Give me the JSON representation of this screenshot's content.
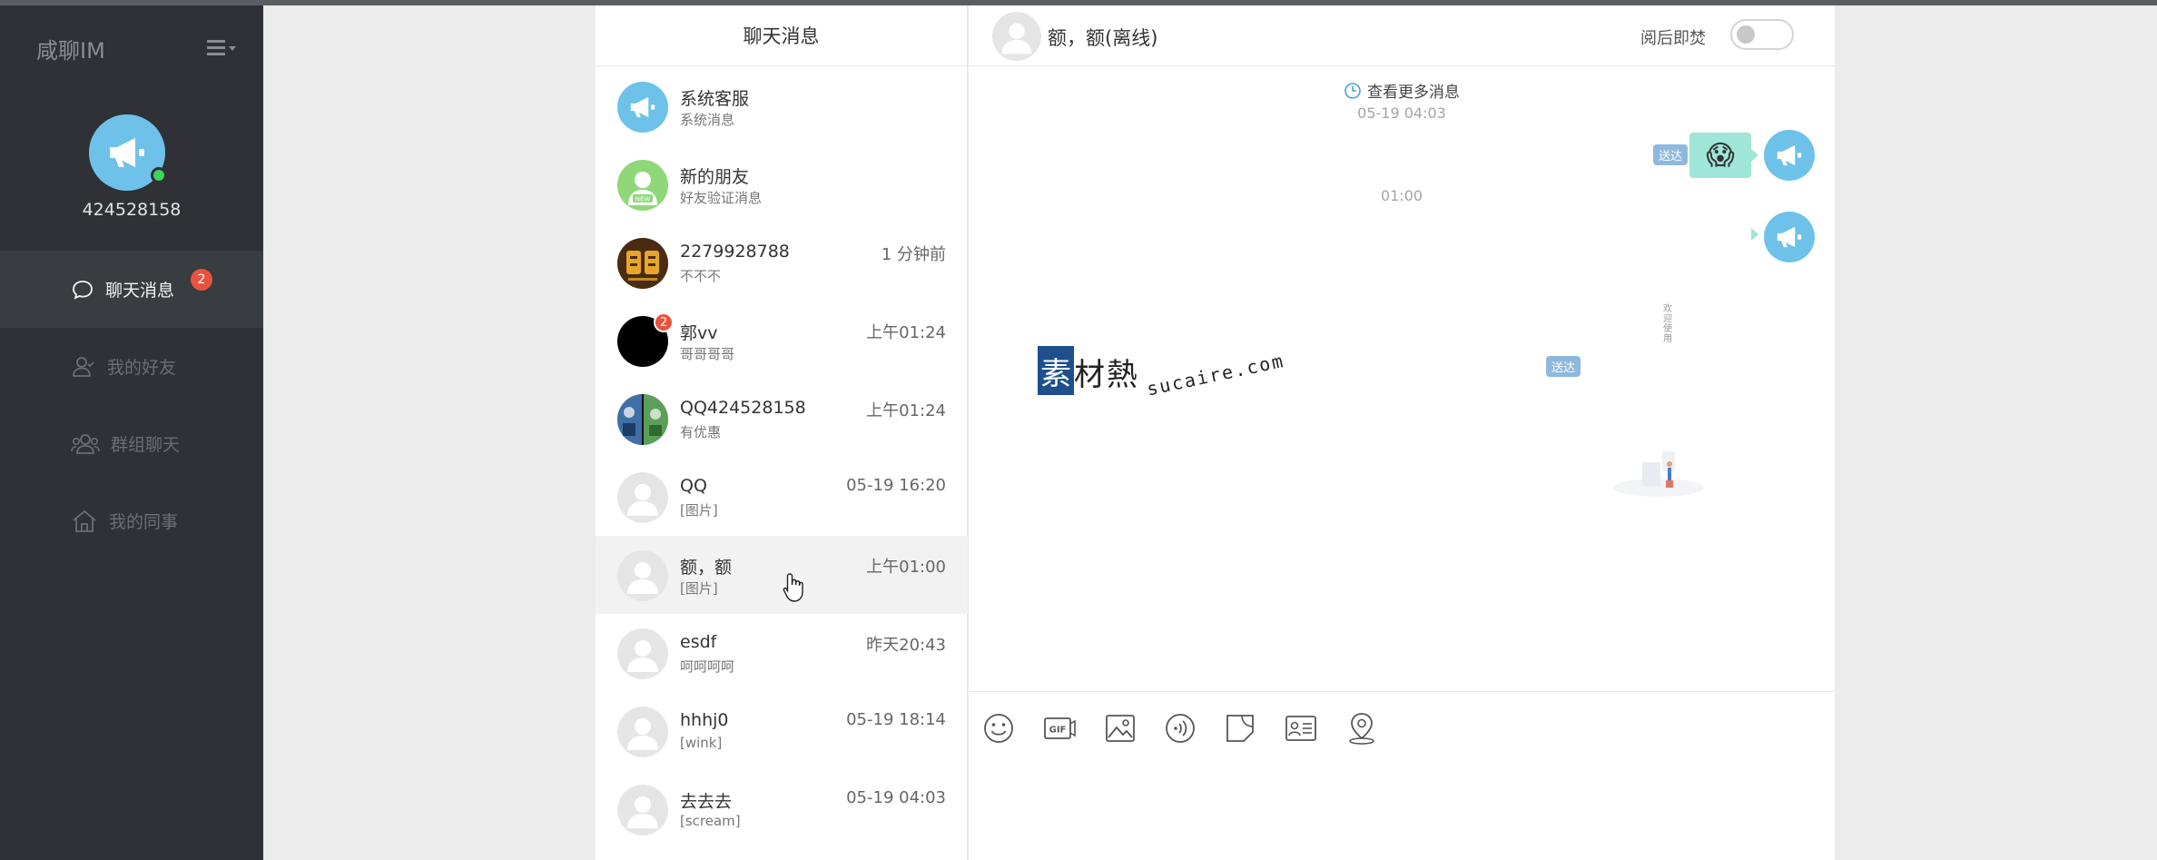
{
  "app": {
    "brand": "咸聊IM"
  },
  "user": {
    "id": "424528158"
  },
  "nav": {
    "items": [
      {
        "label": "聊天消息",
        "badge": "2",
        "active": true
      },
      {
        "label": "我的好友"
      },
      {
        "label": "群组聊天"
      },
      {
        "label": "我的同事"
      }
    ]
  },
  "chatlist": {
    "title": "聊天消息",
    "items": [
      {
        "name": "系统客服",
        "msg": "系统消息",
        "time": "",
        "avatar": "megaphone"
      },
      {
        "name": "新的朋友",
        "msg": "好友验证消息",
        "time": "",
        "avatar": "new-friend"
      },
      {
        "name": "2279928788",
        "msg": "不不不",
        "time": "1 分钟前",
        "avatar": "logo"
      },
      {
        "name": "郭vv",
        "msg": "哥哥哥哥",
        "time": "上午01:24",
        "avatar": "black",
        "badge": "2"
      },
      {
        "name": "QQ424528158",
        "msg": "有优惠",
        "time": "上午01:24",
        "avatar": "photo"
      },
      {
        "name": "QQ",
        "msg": "[图片]",
        "time": "05-19 16:20",
        "avatar": "default"
      },
      {
        "name": "额，额",
        "msg": "[图片]",
        "time": "上午01:00",
        "avatar": "default",
        "hover": true
      },
      {
        "name": "esdf",
        "msg": "呵呵呵呵",
        "time": "昨天20:43",
        "avatar": "default"
      },
      {
        "name": "hhhj0",
        "msg": "[wink]",
        "time": "05-19 18:14",
        "avatar": "default"
      },
      {
        "name": "去去去",
        "msg": "[scream]",
        "time": "05-19 04:03",
        "avatar": "default"
      }
    ]
  },
  "chat": {
    "title": "额，额(离线)",
    "burn_label": "阅后即焚",
    "burn_on": false,
    "more_label": "查看更多消息",
    "timestamps": [
      "05-19 04:03",
      "01:00"
    ],
    "sent_label": "送达",
    "emoji": "😱",
    "watermark": {
      "box": "素",
      "cn": "材熱",
      "en": "sucaire.com"
    },
    "vertical_text": "欢迎使用"
  },
  "toolbar": {
    "tools": [
      "emoji-icon",
      "gif-icon",
      "image-icon",
      "voice-icon",
      "file-icon",
      "card-icon",
      "location-icon"
    ]
  },
  "colors": {
    "sidebar": "#2f3136",
    "accent_blue": "#6ec2ea",
    "badge_red": "#e8533d",
    "bubble": "#9fe5d8"
  }
}
